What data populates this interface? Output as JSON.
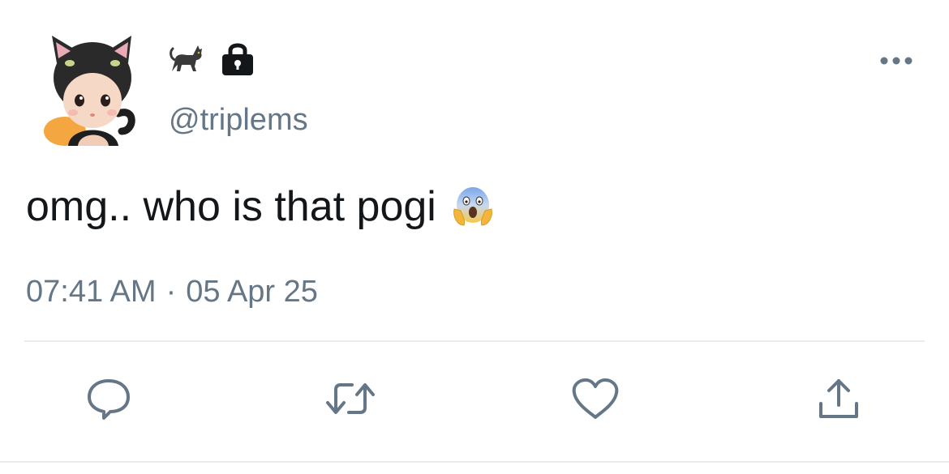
{
  "user": {
    "display_name_icons": [
      "black-cat-emoji-icon",
      "lock-icon"
    ],
    "handle": "@triplems",
    "avatar": "avatar-image"
  },
  "tweet": {
    "text": "omg.. who is that pogi",
    "emoji": "face-screaming-in-fear-icon",
    "time": "07:41 AM",
    "separator": "·",
    "date": "05 Apr 25"
  },
  "actions": {
    "reply": "reply-icon",
    "retweet": "retweet-icon",
    "like": "like-icon",
    "share": "share-icon"
  },
  "colors": {
    "text_primary": "#14171a",
    "text_secondary": "#657786",
    "icon": "#657786",
    "divider": "#e6ecf0"
  }
}
